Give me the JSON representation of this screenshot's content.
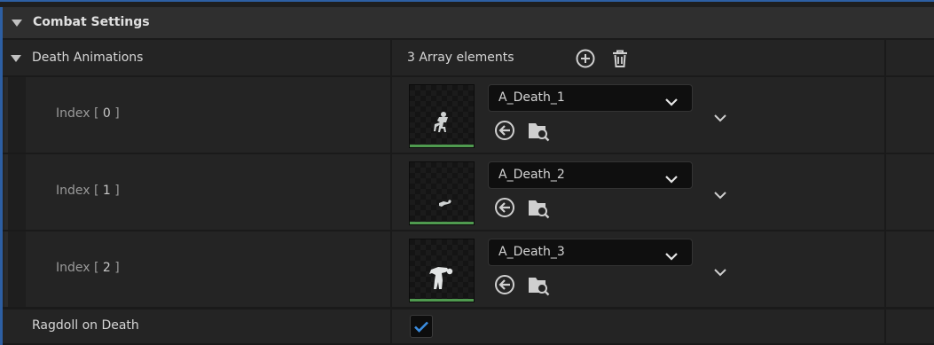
{
  "category": {
    "title": "Combat Settings"
  },
  "death_animations": {
    "label": "Death Animations",
    "count_text": "3 Array elements",
    "elements": [
      {
        "index_prefix": "Index [ ",
        "index": "0",
        "index_suffix": " ]",
        "asset": "A_Death_1"
      },
      {
        "index_prefix": "Index [ ",
        "index": "1",
        "index_suffix": " ]",
        "asset": "A_Death_2"
      },
      {
        "index_prefix": "Index [ ",
        "index": "2",
        "index_suffix": " ]",
        "asset": "A_Death_3"
      }
    ]
  },
  "ragdoll": {
    "label": "Ragdoll on Death",
    "checked": true
  },
  "colors": {
    "accent": "#2d5fa3",
    "thumb_bar": "#4f9a4f",
    "check": "#3b8de0"
  },
  "icons": [
    "add-element-icon",
    "delete-all-icon",
    "use-selected-icon",
    "browse-asset-icon",
    "chevron-down-icon",
    "checkmark-icon"
  ]
}
